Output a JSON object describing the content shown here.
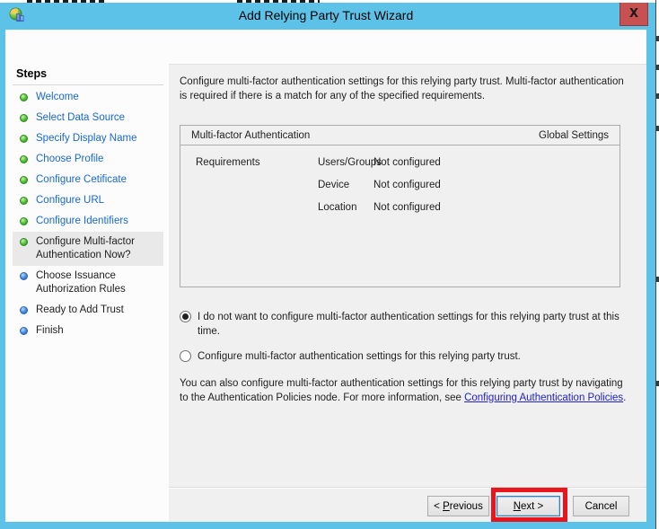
{
  "window": {
    "title": "Add Relying Party Trust Wizard",
    "close_glyph": "X"
  },
  "steps_panel": {
    "header": "Steps",
    "items": [
      {
        "label": "Welcome",
        "state": "done"
      },
      {
        "label": "Select Data Source",
        "state": "done"
      },
      {
        "label": "Specify Display Name",
        "state": "done"
      },
      {
        "label": "Choose Profile",
        "state": "done"
      },
      {
        "label": "Configure Cetificate",
        "state": "done"
      },
      {
        "label": "Configure URL",
        "state": "done"
      },
      {
        "label": "Configure Identifiers",
        "state": "done"
      },
      {
        "label": "Configure Multi-factor Authentication Now?",
        "state": "current"
      },
      {
        "label": "Choose Issuance Authorization Rules",
        "state": "todo"
      },
      {
        "label": "Ready to Add Trust",
        "state": "todo"
      },
      {
        "label": "Finish",
        "state": "todo"
      }
    ]
  },
  "content": {
    "intro": "Configure multi-factor authentication settings for this relying party trust. Multi-factor authentication is required if there is a match for any of the specified requirements.",
    "mfa_box": {
      "title": "Multi-factor Authentication",
      "right_label": "Global Settings",
      "row_group_label": "Requirements",
      "rows": [
        {
          "name": "Users/Groups",
          "value": "Not configured"
        },
        {
          "name": "Device",
          "value": "Not configured"
        },
        {
          "name": "Location",
          "value": "Not configured"
        }
      ]
    },
    "radios": [
      {
        "label": "I do not want to configure multi-factor authentication settings for this relying party trust at this time.",
        "selected": true
      },
      {
        "label": "Configure multi-factor authentication settings for this relying party trust.",
        "selected": false
      }
    ],
    "footer_text_before_link": "You can also configure multi-factor authentication settings for this relying party trust by navigating to the Authentication Policies node. For more information, see ",
    "footer_link": "Configuring Authentication Policies",
    "footer_text_after_link": "."
  },
  "buttons": {
    "previous": {
      "pre": "< ",
      "mnemonic": "P",
      "post": "revious"
    },
    "next": {
      "pre": "",
      "mnemonic": "N",
      "post": "ext >"
    },
    "cancel": "Cancel"
  },
  "colors": {
    "titlebar": "#5CC2E8",
    "close_button": "#C75050",
    "highlight_box": "#E8151D",
    "step_link": "#1668D0",
    "hyperlink": "#2121CC",
    "bullet_done": "#4CBF33",
    "bullet_todo": "#3E86E0"
  }
}
